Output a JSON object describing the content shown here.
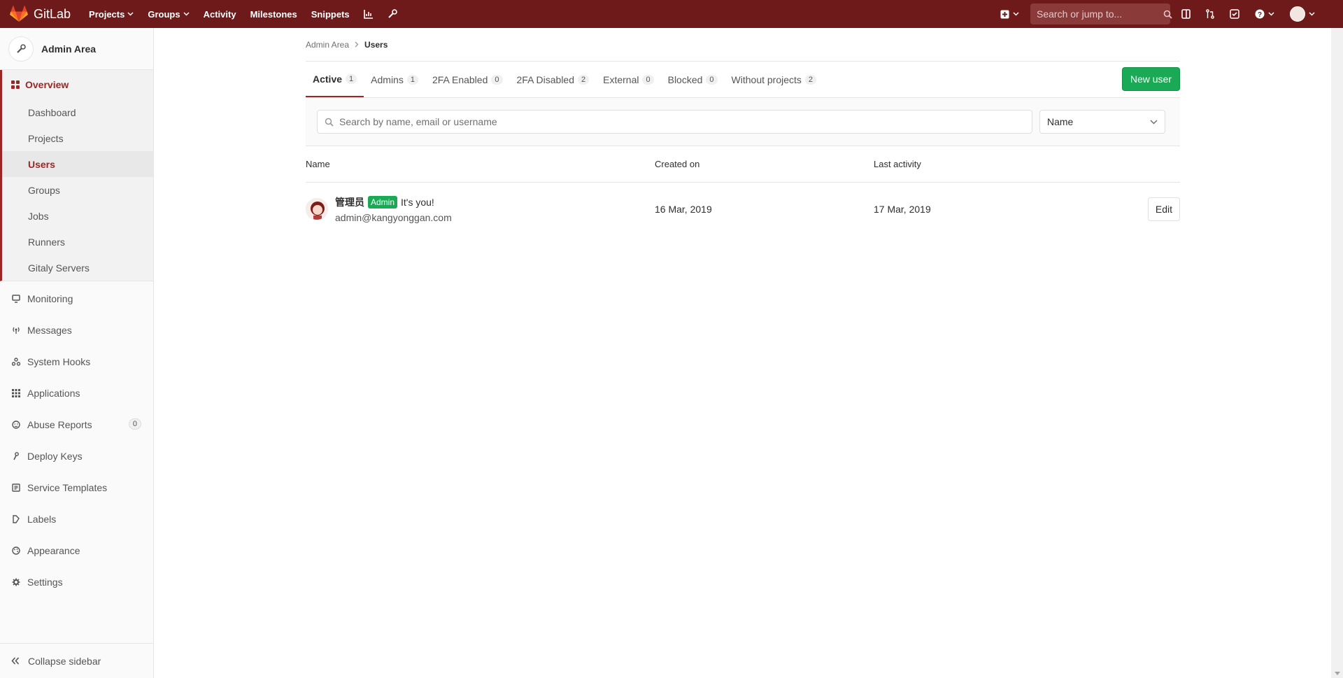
{
  "navbar": {
    "brand": "GitLab",
    "items": [
      {
        "label": "Projects",
        "has_caret": true
      },
      {
        "label": "Groups",
        "has_caret": true
      },
      {
        "label": "Activity",
        "has_caret": false
      },
      {
        "label": "Milestones",
        "has_caret": false
      },
      {
        "label": "Snippets",
        "has_caret": false
      }
    ],
    "search_placeholder": "Search or jump to...",
    "color": "#6e1a1a"
  },
  "sidebar": {
    "title": "Admin Area",
    "overview": {
      "label": "Overview",
      "items": [
        "Dashboard",
        "Projects",
        "Users",
        "Groups",
        "Jobs",
        "Runners",
        "Gitaly Servers"
      ],
      "active": "Users"
    },
    "items": [
      {
        "label": "Monitoring",
        "icon": "monitor-icon"
      },
      {
        "label": "Messages",
        "icon": "broadcast-icon"
      },
      {
        "label": "System Hooks",
        "icon": "hook-icon"
      },
      {
        "label": "Applications",
        "icon": "grid-icon"
      },
      {
        "label": "Abuse Reports",
        "icon": "smiley-icon",
        "badge": "0"
      },
      {
        "label": "Deploy Keys",
        "icon": "key-icon"
      },
      {
        "label": "Service Templates",
        "icon": "template-icon"
      },
      {
        "label": "Labels",
        "icon": "label-icon"
      },
      {
        "label": "Appearance",
        "icon": "palette-icon"
      },
      {
        "label": "Settings",
        "icon": "gear-icon"
      }
    ],
    "collapse_label": "Collapse sidebar"
  },
  "breadcrumb": {
    "parent": "Admin Area",
    "current": "Users"
  },
  "tabs": [
    {
      "label": "Active",
      "count": "1",
      "active": true
    },
    {
      "label": "Admins",
      "count": "1",
      "active": false
    },
    {
      "label": "2FA Enabled",
      "count": "0",
      "active": false
    },
    {
      "label": "2FA Disabled",
      "count": "2",
      "active": false
    },
    {
      "label": "External",
      "count": "0",
      "active": false
    },
    {
      "label": "Blocked",
      "count": "0",
      "active": false
    },
    {
      "label": "Without projects",
      "count": "2",
      "active": false
    }
  ],
  "new_user_label": "New user",
  "filter": {
    "placeholder": "Search by name, email or username",
    "sort_value": "Name"
  },
  "table": {
    "headers": {
      "name": "Name",
      "created": "Created on",
      "activity": "Last activity"
    },
    "rows": [
      {
        "name": "管理员",
        "badge": "Admin",
        "note": "It's you!",
        "email": "admin@kangyonggan.com",
        "created": "16 Mar, 2019",
        "last_activity": "17 Mar, 2019",
        "action": "Edit"
      }
    ]
  },
  "colors": {
    "accent": "#9b2626",
    "success": "#1aaa55"
  }
}
